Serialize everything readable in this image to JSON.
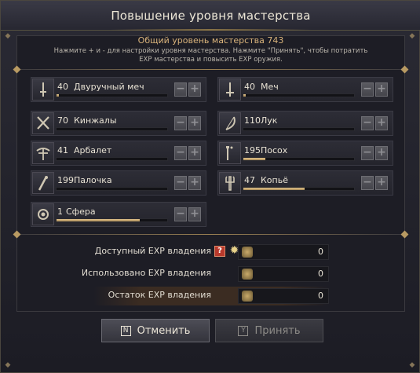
{
  "window": {
    "title": "Повышение уровня мастерства"
  },
  "overall": {
    "text": "Общий уровень мастерства 743"
  },
  "hint": {
    "text": "Нажмите + и - для настройки уровня мастерства. Нажмите \"Принять\", чтобы потратить EXP мастерства и повысить EXP оружия."
  },
  "weapons": [
    {
      "level": "40",
      "name": "Двуручный меч",
      "progress": 0.02,
      "icon": "greatsword-icon"
    },
    {
      "level": "40",
      "name": "Меч",
      "progress": 0.02,
      "icon": "sword-icon"
    },
    {
      "level": "70",
      "name": "Кинжалы",
      "progress": 0.0,
      "icon": "daggers-icon"
    },
    {
      "level": "110",
      "name": "Лук",
      "progress": 0.0,
      "icon": "bow-icon"
    },
    {
      "level": "41",
      "name": "Арбалет",
      "progress": 0.0,
      "icon": "crossbow-icon"
    },
    {
      "level": "195",
      "name": "Посох",
      "progress": 0.2,
      "icon": "staff-icon"
    },
    {
      "level": "199",
      "name": "Палочка",
      "progress": 0.0,
      "icon": "wand-icon"
    },
    {
      "level": "47",
      "name": "Копьё",
      "progress": 0.55,
      "icon": "spear-icon"
    },
    {
      "level": "1",
      "name": "Сфера",
      "progress": 0.75,
      "icon": "orb-icon"
    }
  ],
  "buttons": {
    "minus": "−",
    "plus": "+"
  },
  "exp": {
    "available_label": "Доступный EXP владения",
    "available_value": "0",
    "used_label": "Использовано EXP владения",
    "used_value": "0",
    "remaining_label": "Остаток EXP владения",
    "remaining_value": "0",
    "help": "?",
    "sun": "✹"
  },
  "actions": {
    "cancel_key": "N",
    "cancel_label": "Отменить",
    "accept_key": "Y",
    "accept_label": "Принять"
  },
  "colors": {
    "accent": "#d8b27a",
    "bar_fill": "#d2b47c",
    "panel": "#1d1d25"
  }
}
